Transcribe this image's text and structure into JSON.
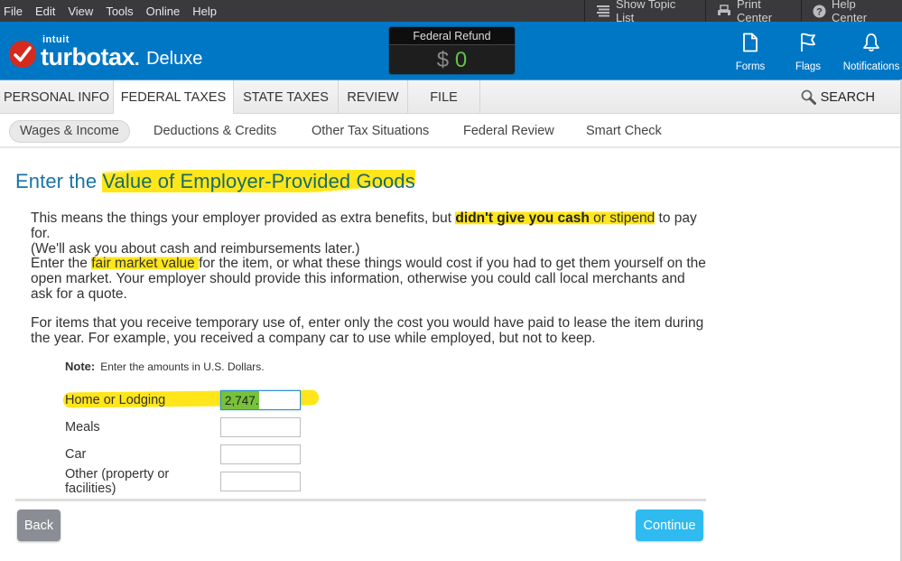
{
  "menubar": {
    "items": [
      "File",
      "Edit",
      "View",
      "Tools",
      "Online",
      "Help"
    ],
    "right_buttons": [
      {
        "label": "Show Topic List",
        "icon": "list-icon"
      },
      {
        "label": "Print Center",
        "icon": "printer-icon"
      },
      {
        "label": "Help Center",
        "icon": "help-circle-icon"
      }
    ]
  },
  "header": {
    "brand_small": "intuit",
    "brand": "turbotax",
    "edition": "Deluxe",
    "refund": {
      "label": "Federal Refund",
      "currency": "$",
      "amount": "0"
    },
    "tools": [
      {
        "label": "Forms",
        "icon": "document-icon"
      },
      {
        "label": "Flags",
        "icon": "flag-icon"
      },
      {
        "label": "Notifications",
        "icon": "bell-icon"
      }
    ],
    "colors": {
      "brand_blue": "#0077c5",
      "refund_green": "#5fc24b",
      "logo_red": "#d52b1e"
    }
  },
  "tabs": {
    "items": [
      "PERSONAL INFO",
      "FEDERAL TAXES",
      "STATE TAXES",
      "REVIEW",
      "FILE"
    ],
    "active": "FEDERAL TAXES",
    "search_label": "SEARCH"
  },
  "subnav": {
    "items": [
      "Wages & Income",
      "Deductions & Credits",
      "Other Tax Situations",
      "Federal Review",
      "Smart Check"
    ],
    "active": "Wages & Income"
  },
  "page": {
    "title_prefix": "Enter the ",
    "title_highlight": "Value of Employer-Provided Goods",
    "p1": {
      "a": "This means the things your employer provided as extra benefits, but ",
      "bold_hl": "didn't give you cash",
      "hl": " or stipend",
      "b": " to pay for.",
      "line2": "(We'll ask you about cash and reimbursements later.)"
    },
    "p2": {
      "a": "Enter the ",
      "hl": "fair market value ",
      "b": "for the item, or what these things would cost if you had to get them yourself on the open market. Your employer should provide this information, otherwise you could call local merchants and ask for a quote."
    },
    "p3": "For items that you receive temporary use of, enter only the cost you would have paid to lease the item during the year. For example, you received a company car to use while employed, but not to keep.",
    "note_label": "Note:",
    "note_text": "Enter the amounts in U.S. Dollars.",
    "fields": [
      {
        "label": "Home or Lodging",
        "value": "2,747."
      },
      {
        "label": "Meals",
        "value": ""
      },
      {
        "label": "Car",
        "value": ""
      },
      {
        "label": "Other (property or facilities)",
        "value": ""
      }
    ],
    "back_label": "Back",
    "continue_label": "Continue",
    "colors": {
      "title": "#1a73a8",
      "highlight": "#ffe61a",
      "continue": "#2fbaf0",
      "back": "#8a8d93"
    }
  }
}
